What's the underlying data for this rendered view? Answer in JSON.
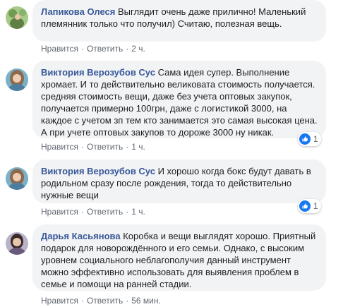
{
  "colors": {
    "author": "#385898",
    "bubble_bg": "#f2f3f5",
    "meta": "#606770",
    "like_blue": "#1877f2"
  },
  "actions": {
    "like": "Нравится",
    "reply": "Ответить"
  },
  "comments": [
    {
      "author": "Лапикова Олеся",
      "text": "Выглядит очень даже прилично! Маленький племянник только что получил) Считаю, полезная вещь.",
      "time": "2 ч."
    },
    {
      "author": "Виктория Верозубов Сус",
      "text": "Сама идея супер. Выполнение хромает. И то действительно великовата стоимость получается. средняя стоимость вещи, даже без учета оптовых закупок, получается примерно 100грн, даже с логистикой 3000, на каждое с учетом зп тем кто занимается это самая высокая цена. А при учете оптовых закупов то дороже 3000 ну никак.",
      "time": "1 ч.",
      "reaction": {
        "icon": "like-icon",
        "count": "1"
      }
    },
    {
      "author": "Виктория Верозубов Сус",
      "text": "И хорошо когда бокс будут давать в родильном сразу после рождения, тогда то действительно нужные вещи",
      "time": "1 ч.",
      "reaction": {
        "icon": "like-icon",
        "count": "1"
      }
    },
    {
      "author": "Дарья Касьянова",
      "text": "Коробка и вещи выглядят хорошо. Приятный подарок для новорождённого и его семьи. Однако, с высоким уровнем социального неблагополучия данный инструмент можно эффективно использовать для выявления проблем в семье и помощи на ранней стадии.",
      "time": "56 мин."
    }
  ]
}
